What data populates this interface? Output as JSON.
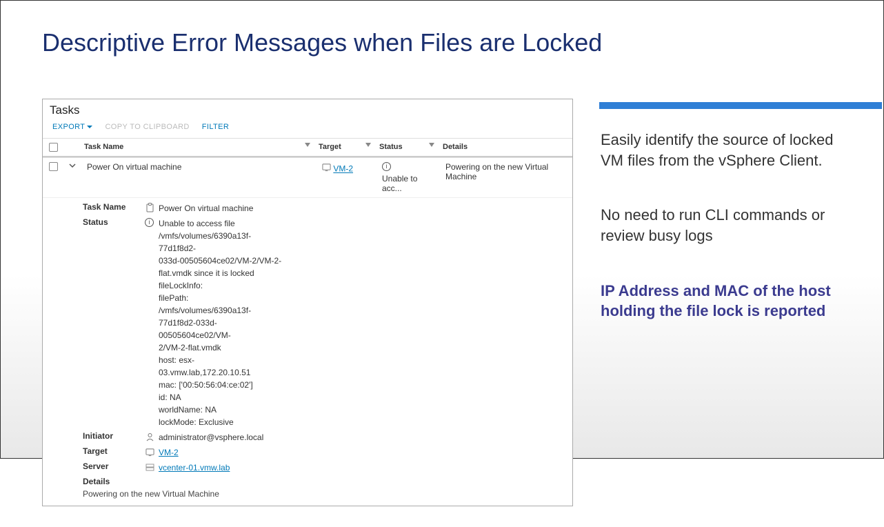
{
  "title": "Descriptive Error Messages when Files are Locked",
  "bullets": {
    "b1": "Easily identify the source of locked VM files from the vSphere Client.",
    "b2": "No need to run CLI commands or review busy logs",
    "b3": "IP Address and MAC of the host holding the file lock is reported"
  },
  "tasks": {
    "panel_title": "Tasks",
    "toolbar": {
      "export": "EXPORT",
      "copy": "COPY TO CLIPBOARD",
      "filter": "FILTER"
    },
    "columns": {
      "task_name": "Task Name",
      "target": "Target",
      "status": "Status",
      "details": "Details"
    },
    "row": {
      "task_name": "Power On virtual machine",
      "target": "VM-2",
      "status_short": "Unable to acc...",
      "details": "Powering on the new Virtual Machine"
    },
    "expanded": {
      "task_name_label": "Task Name",
      "task_name_value": "Power On virtual machine",
      "status_label": "Status",
      "status_lines": [
        "Unable to access file",
        "/vmfs/volumes/6390a13f-77d1f8d2-",
        "033d-00505604ce02/VM-2/VM-2-",
        "flat.vmdk since it is locked",
        "fileLockInfo:",
        "filePath: /vmfs/volumes/6390a13f-",
        "77d1f8d2-033d-00505604ce02/VM-",
        "2/VM-2-flat.vmdk",
        "host: esx-03.vmw.lab,172.20.10.51",
        "mac: ['00:50:56:04:ce:02']",
        "id: NA",
        "worldName: NA",
        "lockMode: Exclusive"
      ],
      "initiator_label": "Initiator",
      "initiator_value": "administrator@vsphere.local",
      "target_label": "Target",
      "target_value": "VM-2",
      "server_label": "Server",
      "server_value": "vcenter-01.vmw.lab",
      "details_label": "Details",
      "details_value": "Powering on the new Virtual Machine"
    }
  }
}
